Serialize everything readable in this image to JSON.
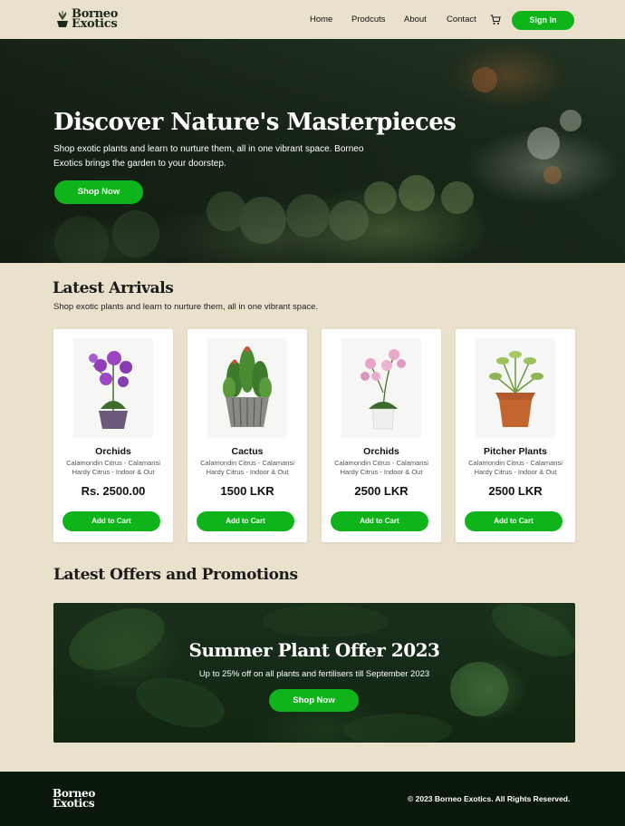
{
  "nav": {
    "logo_line1": "Borneo",
    "logo_line2": "Exotics",
    "links": [
      "Home",
      "Prodcuts",
      "About",
      "Contact"
    ],
    "cart_icon": "cart-icon",
    "signin_label": "Sign In"
  },
  "hero": {
    "title": "Discover Nature's Masterpieces",
    "subtitle": "Shop exotic plants and learn to nurture them, all in one vibrant space. Borneo Exotics brings the garden to your doorstep.",
    "button_label": "Shop Now"
  },
  "latest": {
    "title": "Latest Arrivals",
    "subtitle": "Shop exotic plants and learn to nurture them, all in one vibrant space.",
    "products": [
      {
        "name": "Orchids",
        "desc": "Calamondin Citrus - Calamansi Hardy Citrus - Indoor & Out",
        "price": "Rs. 2500.00",
        "button": "Add to Cart",
        "image": "purple-orchid"
      },
      {
        "name": "Cactus",
        "desc": "Calamondin Citrus - Calamansi Hardy Citrus - Indoor & Out",
        "price": "1500 LKR",
        "button": "Add to Cart",
        "image": "cactus-pot"
      },
      {
        "name": "Orchids",
        "desc": "Calamondin Citrus - Calamansi Hardy Citrus - Indoor & Out",
        "price": "2500 LKR",
        "button": "Add to Cart",
        "image": "pink-orchid"
      },
      {
        "name": "Pitcher Plants",
        "desc": "Calamondin Citrus - Calamansi Hardy Citrus - Indoor & Out",
        "price": "2500 LKR",
        "button": "Add to Cart",
        "image": "pitcher-plant"
      }
    ]
  },
  "offers": {
    "title": "Latest Offers and Promotions",
    "promo_title": "Summer Plant Offer 2023",
    "promo_subtitle": "Up to 25% off on all plants and fertilisers till September 2023",
    "promo_button": "Shop Now"
  },
  "footer": {
    "logo_line1": "Borneo",
    "logo_line2": "Exotics",
    "copyright": "© 2023 Borneo Exotics. All Rights Reserved."
  },
  "colors": {
    "accent": "#0fb41a",
    "background": "#e9e1cb",
    "footer": "#091809"
  }
}
